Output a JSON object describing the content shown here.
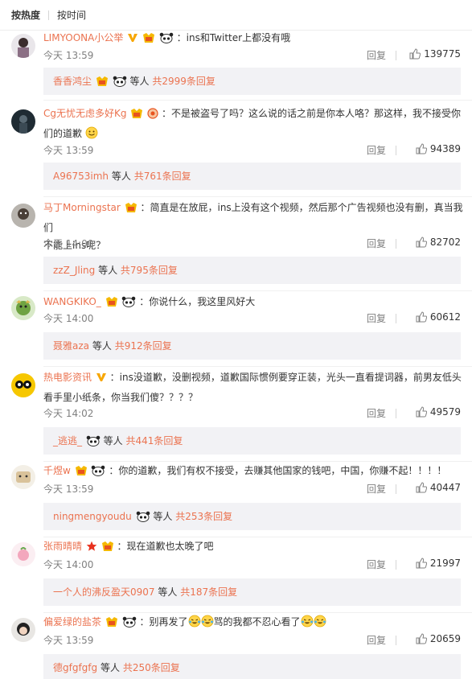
{
  "sort": {
    "hot_label": "按热度",
    "time_label": "按时间"
  },
  "reply_label": "回复",
  "comments": [
    {
      "user": "LIMYOONA小公举",
      "text": "：ins和Twitter上都没有哦",
      "time": "今天 13:59",
      "likes": "139775",
      "sub_user": "香香鸿尘",
      "sub_people": "等人",
      "sub_more": "共2999条回复"
    },
    {
      "user": "Cg无忧无虑多好Kg",
      "text_line1": "：不是被盗号了吗？这么说的话之前是你本人咯？那这样，我不接受你",
      "text_line2": "们的道歉",
      "time": "今天 13:59",
      "likes": "94389",
      "sub_user": "A96753imh",
      "sub_people": "等人",
      "sub_more": "共761条回复"
    },
    {
      "user": "马丁Morningstar",
      "text_line1": "：简直是在放屁，ins上没有这个视频，然后那个广告视频也没有删，真当我们",
      "text_line2": "不能上ins呢？",
      "time": "今天 14:00",
      "likes": "82702",
      "sub_user": "zzZ_Jling",
      "sub_people": "等人",
      "sub_more": "共795条回复"
    },
    {
      "user": "WANGKIKO_",
      "text": "：你说什么，我这里风好大",
      "time": "今天 14:00",
      "likes": "60612",
      "sub_user": "聂雅aza",
      "sub_people": "等人",
      "sub_more": "共912条回复"
    },
    {
      "user": "热电影资讯",
      "text_line1": "：ins没道歉，没删视频，道歉国际惯例要穿正装，光头一直看提词器，前男友低头",
      "text_line2": "看手里小纸条，你当我们傻？？？？",
      "time": "今天 14:02",
      "likes": "49579",
      "sub_user": "_逃逃_",
      "sub_people": "等人",
      "sub_more": "共441条回复"
    },
    {
      "user": "千煜w",
      "text": "：你的道歉，我们有权不接受，去赚其他国家的钱吧，中国，你赚不起！！！！",
      "time": "今天 13:59",
      "likes": "40447",
      "sub_user": "ningmengyoudu",
      "sub_people": "等人",
      "sub_more": "共253条回复"
    },
    {
      "user": "张雨晴晴",
      "text": "：现在道歉也太晚了吧",
      "time": "今天 14:00",
      "likes": "21997",
      "sub_user": "一个人的沸反盈天0907",
      "sub_people": "等人",
      "sub_more": "共187条回复"
    },
    {
      "user": "偏爱绿的盐茶",
      "text_a": "：别再发了",
      "text_b": "骂的我都不忍心看了",
      "time": "今天 13:59",
      "likes": "20659",
      "sub_user": "德gfgfgfg",
      "sub_people": "等人",
      "sub_more": "共250条回复"
    }
  ],
  "colors": {
    "link": "#eb7350",
    "meta": "#808080",
    "sub_bg": "#f2f2f5"
  },
  "icons": [
    "vip-v-icon",
    "fan-badge-icon",
    "panda-emoji-icon",
    "like-thumb-icon",
    "smile-emoji-icon",
    "laugh-cry-emoji-icon",
    "red-star-icon"
  ]
}
